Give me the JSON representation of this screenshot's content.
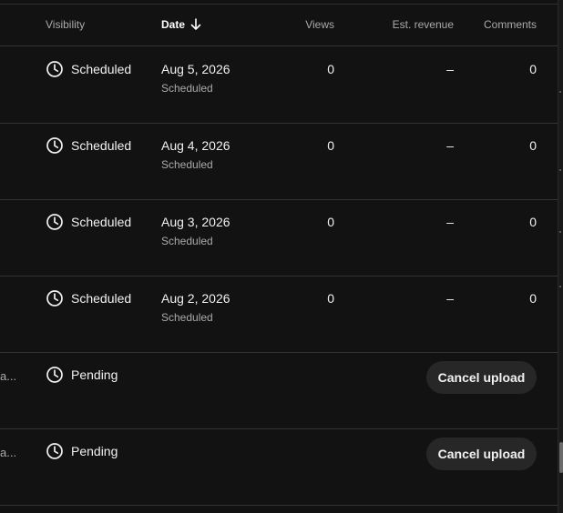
{
  "header": {
    "visibility": "Visibility",
    "date": "Date",
    "views": "Views",
    "revenue": "Est. revenue",
    "comments": "Comments"
  },
  "rows": [
    {
      "visibility": "Scheduled",
      "date": "Aug 5, 2026",
      "date_sub": "Scheduled",
      "views": "0",
      "revenue": "–",
      "comments": "0"
    },
    {
      "visibility": "Scheduled",
      "date": "Aug 4, 2026",
      "date_sub": "Scheduled",
      "views": "0",
      "revenue": "–",
      "comments": "0"
    },
    {
      "visibility": "Scheduled",
      "date": "Aug 3, 2026",
      "date_sub": "Scheduled",
      "views": "0",
      "revenue": "–",
      "comments": "0"
    },
    {
      "visibility": "Scheduled",
      "date": "Aug 2, 2026",
      "date_sub": "Scheduled",
      "views": "0",
      "revenue": "–",
      "comments": "0"
    }
  ],
  "pending_rows": [
    {
      "title_fragment": "a...",
      "visibility": "Pending",
      "action": "Cancel upload"
    },
    {
      "title_fragment": "a...",
      "visibility": "Pending",
      "action": "Cancel upload"
    }
  ],
  "icons": {
    "visibility": "clock-icon",
    "sort": "arrow-down-icon"
  }
}
